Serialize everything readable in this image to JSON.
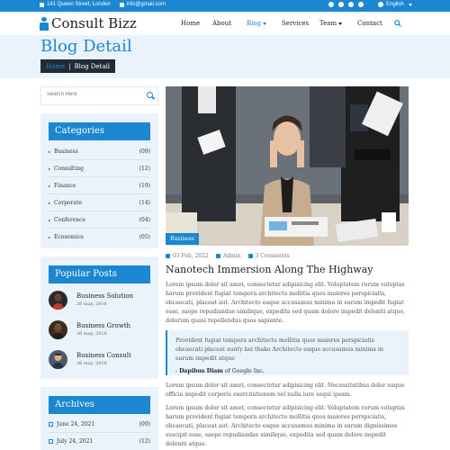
{
  "topbar": {
    "address": "141 Queen Street, London",
    "email": "info@gmail.com",
    "social_icons": [
      "facebook-icon",
      "twitter-icon",
      "linkedin-icon",
      "vimeo-icon"
    ],
    "language": "English"
  },
  "header": {
    "logo_text": "Consult Bizz",
    "nav": [
      {
        "label": "Home"
      },
      {
        "label": "About"
      },
      {
        "label": "Blog"
      },
      {
        "label": "Services"
      },
      {
        "label": "Team"
      },
      {
        "label": "Contact"
      }
    ]
  },
  "hero": {
    "title": "Blog Detail",
    "breadcrumb_home": "Home",
    "breadcrumb_sep": "|",
    "breadcrumb_current": "Blog Detail"
  },
  "search": {
    "placeholder": "Search Here"
  },
  "categories": {
    "title": "Categories",
    "items": [
      {
        "name": "Business",
        "count": "(09)"
      },
      {
        "name": "Consulting",
        "count": "(12)"
      },
      {
        "name": "Finance",
        "count": "(19)"
      },
      {
        "name": "Corporate",
        "count": "(14)"
      },
      {
        "name": "Conference",
        "count": "(04)"
      },
      {
        "name": "Economics",
        "count": "(05)"
      }
    ]
  },
  "popular": {
    "title": "Popular Posts",
    "items": [
      {
        "title": "Business Solution",
        "date": "26 may, 2018"
      },
      {
        "title": "Business Growth",
        "date": "26 may, 2018"
      },
      {
        "title": "Business Consult",
        "date": "26 may, 2018"
      }
    ]
  },
  "archives": {
    "title": "Archives",
    "items": [
      {
        "date": "June 24, 2021",
        "count": "(09)"
      },
      {
        "date": "July 24, 2021",
        "count": "(12)"
      }
    ]
  },
  "post": {
    "tag": "Business",
    "date": "03 Feb, 2022",
    "author": "Admin",
    "comments": "3 Comments",
    "title": "Nanotech Immersion Along The Highway",
    "para1": "Lorem ipsum dolor sit amet, consectetur adipisicing elit. Voluptatem rerum voluptas harum provident fugiat tempora architecto mollitia quos maiores perspiciatis, obcaecati, placeat aut. Architecto eaque accusamus minima in earum impedit fugiat esse, saepe repudiandae similique, expedita sed quam dolore impedit deleniti atque, dolorum quasi repellendus quos sapiente.",
    "quote_text": "Provident fugiat tempora architecto mollitia quos maiores perspiciatis obcaecati placeat aunty kei thako Architecto eaque accusamus minima in earum impedit atque",
    "quote_author": "Dapibus Diam",
    "quote_source": "of Google Inc.",
    "para2": "Lorem ipsum dolor sit amet, consectetur adipisicing elit. Necessitatibus dolor eaque officia impedit corporis exercitationem vel nulla iure sequi ipsam.",
    "para3": "Lorem ipsum dolor sit amet, consectetur adipisicing elit. Voluptatem rerum voluptas harum provident fugiat tempora architecto mollitia quos maiores perspiciatis, obcaecati, placeat aut. Architecto eaque accusamus minima in earum dignissimos suscipit esse, saepe repudiandae similique, expedita sed quam dolore impedit deleniti atque."
  },
  "colors": {
    "accent": "#1a87d0",
    "dark": "#212b36",
    "light_bg": "#eaf3fb"
  }
}
